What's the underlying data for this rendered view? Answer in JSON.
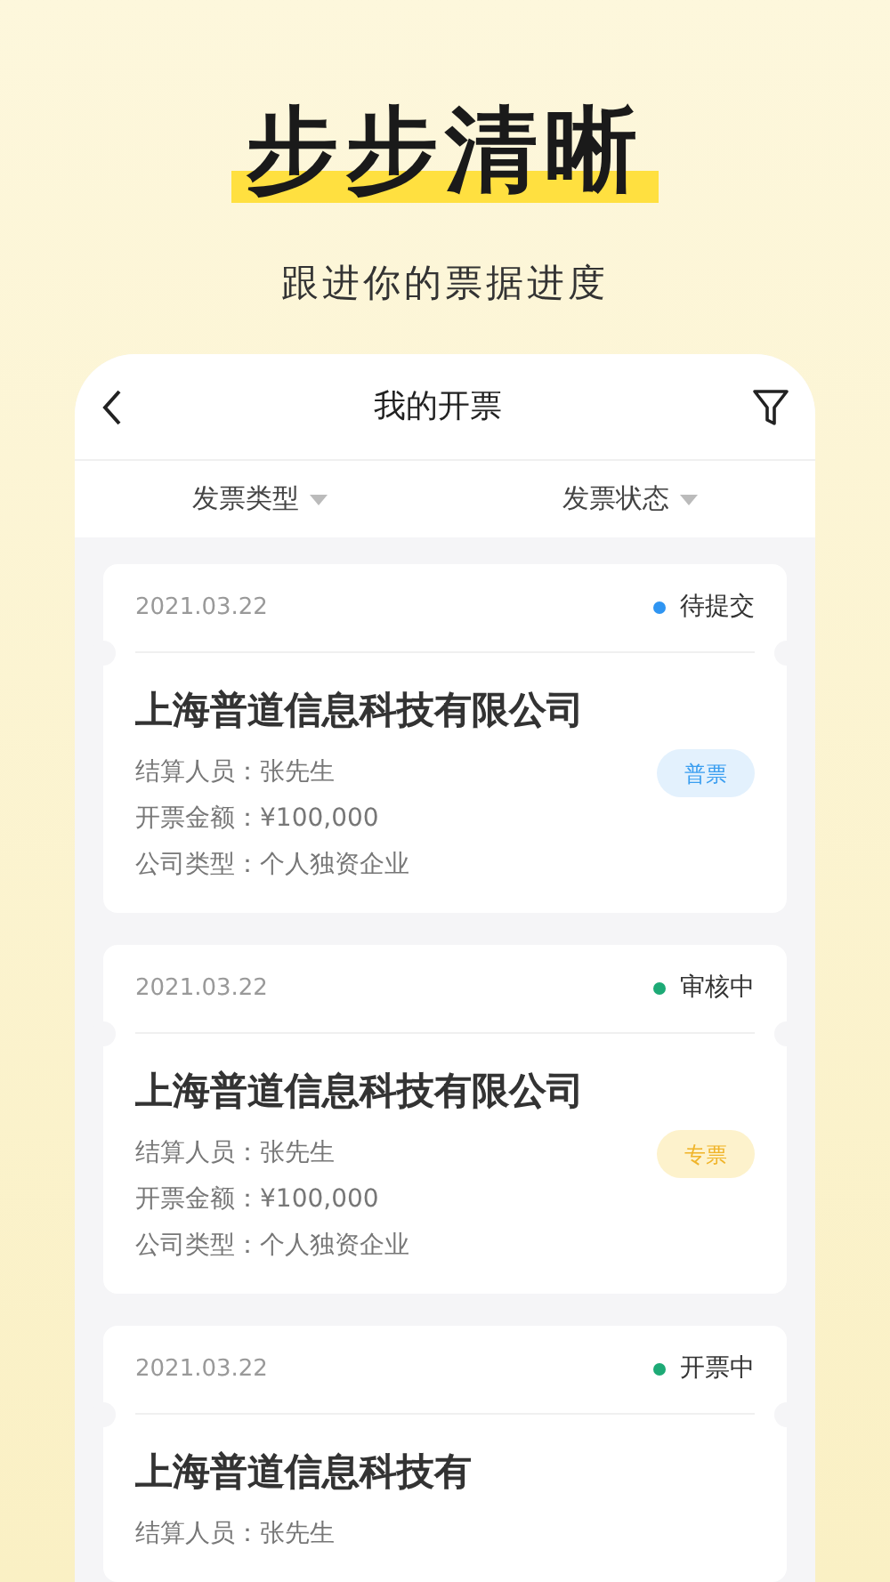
{
  "headline": "步步清晰",
  "subtitle": "跟进你的票据进度",
  "screen": {
    "title": "我的开票",
    "filters": [
      {
        "label": "发票类型"
      },
      {
        "label": "发票状态"
      }
    ],
    "invoices": [
      {
        "date": "2021.03.22",
        "status": "待提交",
        "color": "#2f95f2",
        "company": "上海普道信息科技有限公司",
        "lines": [
          {
            "label": "结算人员：",
            "value": "张先生"
          },
          {
            "label": "开票金额：",
            "value": "¥100,000"
          },
          {
            "label": "公司类型：",
            "value": "个人独资企业"
          }
        ],
        "badge": {
          "text": "普票",
          "kind": "general"
        }
      },
      {
        "date": "2021.03.22",
        "status": "审核中",
        "color": "#1daa76",
        "company": "上海普道信息科技有限公司",
        "lines": [
          {
            "label": "结算人员：",
            "value": "张先生"
          },
          {
            "label": "开票金额：",
            "value": "¥100,000"
          },
          {
            "label": "公司类型：",
            "value": "个人独资企业"
          }
        ],
        "badge": {
          "text": "专票",
          "kind": "special"
        }
      },
      {
        "date": "2021.03.22",
        "status": "开票中",
        "color": "#1daa76",
        "company": "上海普道信息科技有",
        "lines": [
          {
            "label": "结算人员：",
            "value": "张先生"
          }
        ]
      }
    ]
  }
}
